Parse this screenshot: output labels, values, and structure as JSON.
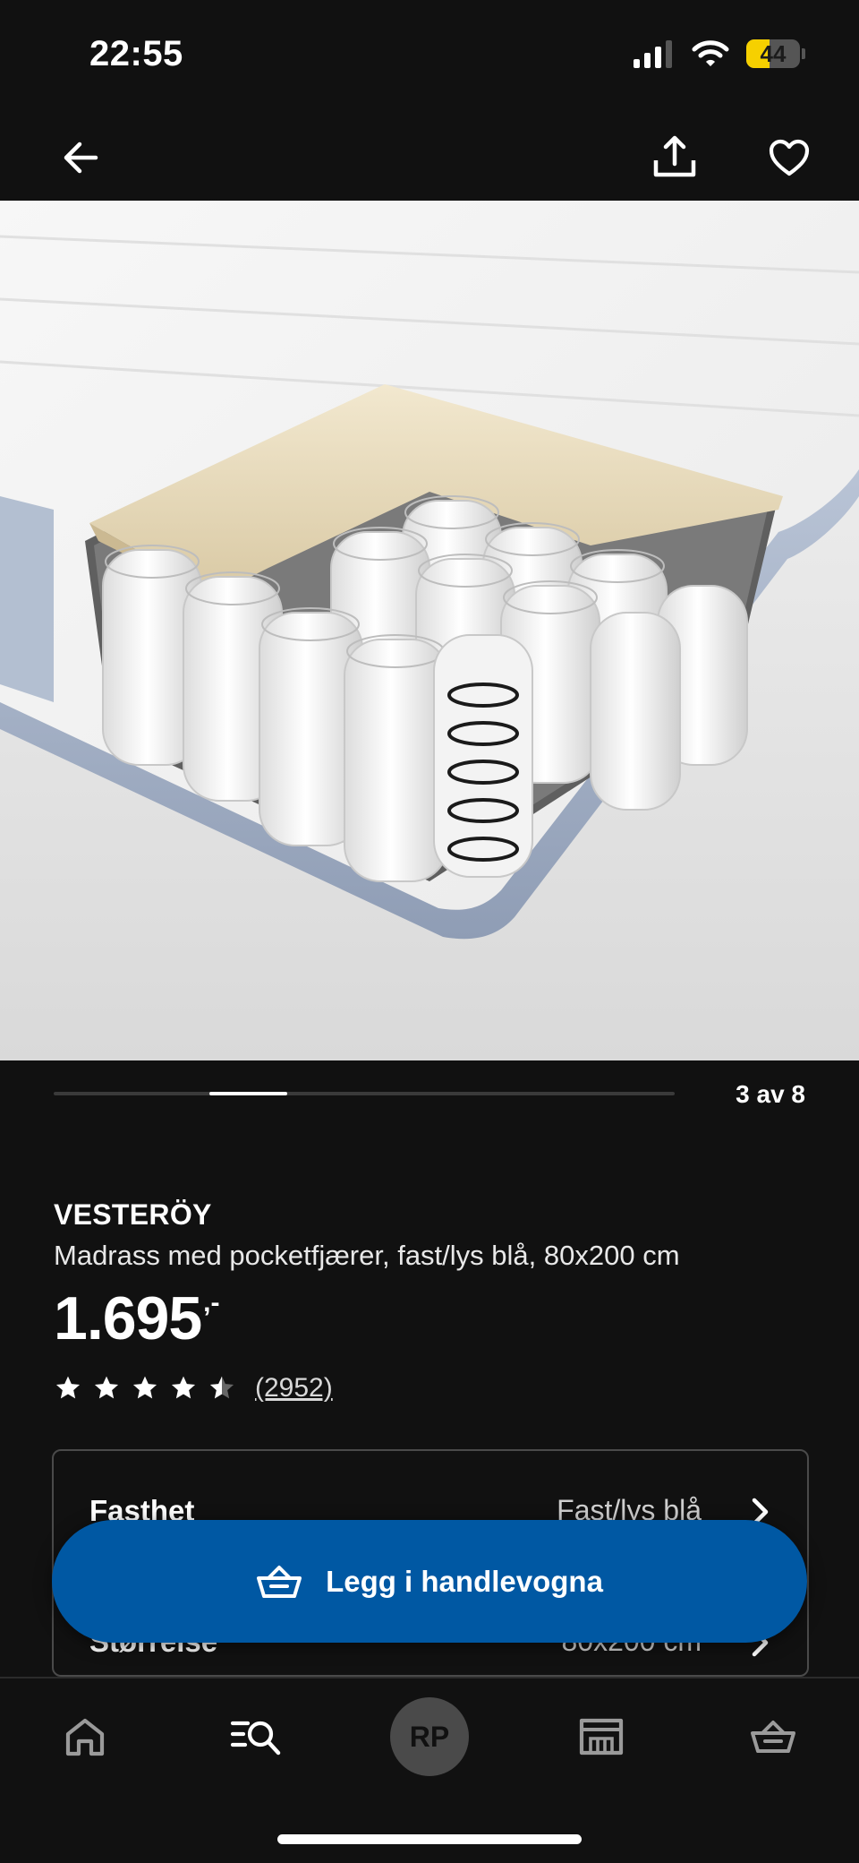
{
  "status_bar": {
    "time": "22:55",
    "battery_level": "44"
  },
  "product_image": {
    "alt": "VESTERÖY pocket spring mattress cutaway"
  },
  "carousel": {
    "counter": "3 av 8",
    "current": 3,
    "total": 8
  },
  "product": {
    "brand": "VESTERÖY",
    "description": "Madrass med pocketfjærer, fast/lys blå, 80x200 cm",
    "price": "1.695",
    "price_suffix": ",-",
    "rating": 4.5,
    "review_count": "(2952)"
  },
  "options": [
    {
      "label": "Fasthet",
      "value": "Fast/lys blå"
    },
    {
      "label": "Størrelse",
      "value": "80x200 cm"
    }
  ],
  "cart_button": {
    "label": "Legg i handlevogna"
  },
  "nav": {
    "avatar_initials": "RP"
  },
  "colors": {
    "accent": "#0058a3",
    "background": "#111111",
    "battery": "#f6d000"
  }
}
